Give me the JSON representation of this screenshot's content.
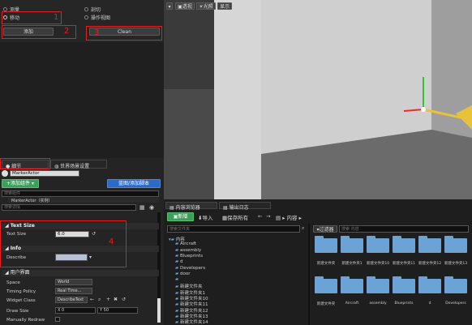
{
  "top_options": {
    "measure": "测量",
    "cut": "剖切",
    "move": "移动",
    "scene_view": "操作视图"
  },
  "buttons": {
    "add": "添加",
    "clean": "Clean"
  },
  "annotations": [
    "1",
    "2",
    "3",
    "4"
  ],
  "details": {
    "tab_details": "细节",
    "tab_world": "世界场景设置",
    "actor_name": "MarkerActor",
    "add_component": "+添加组件 ▾",
    "blueprint_btn": "蓝图/添加脚本",
    "search_placeholder": "搜索组件",
    "component_item": "MarkerActor（实例）",
    "details_search": "搜索详情",
    "text_size_section": "Text Size",
    "text_size_label": "Text Size",
    "text_size_value": "6.0",
    "info_section": "Info",
    "describe_label": "Describe",
    "ui_section": "用户界面",
    "space_label": "Space",
    "space_value": "World",
    "timing_label": "Timing Policy",
    "timing_value": "Real Time...",
    "widget_label": "Widget Class",
    "widget_value": "DescribeText",
    "draw_label": "Draw Size",
    "draw_x": "X  0",
    "draw_y": "Y  50",
    "redraw_label": "Manually Redraw"
  },
  "viewport": {
    "perspective": "透视",
    "lit": "光照",
    "show": "显示"
  },
  "content_browser": {
    "tab1": "内容浏览器",
    "tab2": "输出日志",
    "new_btn": "新增",
    "import_btn": "导入",
    "save_btn": "保存所有",
    "path": "内容",
    "search_folders": "搜索文件夹",
    "filter": "过滤器",
    "search_content": "搜索 内容",
    "tree": [
      "内容",
      "Aircraft",
      "assembly",
      "Blueprints",
      "d",
      "Developers",
      "door",
      "",
      "新建文件夹",
      "新建文件夹1",
      "新建文件夹10",
      "新建文件夹11",
      "新建文件夹12",
      "新建文件夹13",
      "新建文件夹14"
    ],
    "grid_row1": [
      "新建文件夹",
      "新建文件夹1",
      "新建文件夹10",
      "新建文件夹11",
      "新建文件夹12",
      "新建文件夹13"
    ],
    "grid_row2": [
      "新建文件夹",
      "Aircraft",
      "assembly",
      "Blueprints",
      "d",
      "Developers"
    ]
  },
  "colors": {
    "red": "#e02020",
    "accent_blue": "#2c6ac8",
    "folder": "#6ba3d6"
  }
}
